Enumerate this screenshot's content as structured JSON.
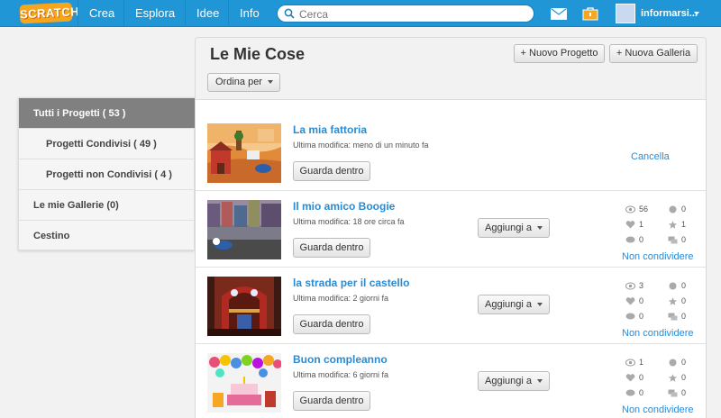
{
  "nav": {
    "logo": "SCRATCH",
    "items": [
      "Crea",
      "Esplora",
      "Idee",
      "Info"
    ],
    "search_placeholder": "Cerca",
    "username": "informarsi..."
  },
  "sidebar": {
    "items": [
      {
        "label": "Tutti i Progetti ( 53 )",
        "active": true
      },
      {
        "label": "Progetti Condivisi ( 49 )"
      },
      {
        "label": "Progetti non Condivisi ( 4 )"
      },
      {
        "label": "Le mie Gallerie (0)"
      },
      {
        "label": "Cestino"
      }
    ]
  },
  "main": {
    "title": "Le Mie Cose",
    "new_project": "+ Nuovo Progetto",
    "new_gallery": "+ Nuova Galleria",
    "sort_label": "Ordina per",
    "see_inside": "Guarda dentro",
    "add_to": "Aggiungi a",
    "delete": "Cancella",
    "unshare": "Non condividere"
  },
  "projects": [
    {
      "title": "La mia fattoria",
      "modified": "Ultima modifica: meno di un minuto fa",
      "shared": false
    },
    {
      "title": "Il mio amico Boogie",
      "modified": "Ultima modifica: 18 ore circa fa",
      "shared": true,
      "stats": {
        "views": "56",
        "loves": "1",
        "comments": "0",
        "remixes": "0",
        "favorites": "1",
        "studios": "0"
      }
    },
    {
      "title": "la strada per il castello",
      "modified": "Ultima modifica: 2 giorni fa",
      "shared": true,
      "stats": {
        "views": "3",
        "loves": "0",
        "comments": "0",
        "remixes": "0",
        "favorites": "0",
        "studios": "0"
      }
    },
    {
      "title": "Buon compleanno",
      "modified": "Ultima modifica: 6 giorni fa",
      "shared": true,
      "stats": {
        "views": "1",
        "loves": "0",
        "comments": "0",
        "remixes": "0",
        "favorites": "0",
        "studios": "0"
      }
    }
  ],
  "colors": {
    "nav": "#2196d6",
    "link": "#2a8bd3",
    "active_side": "#808080"
  }
}
